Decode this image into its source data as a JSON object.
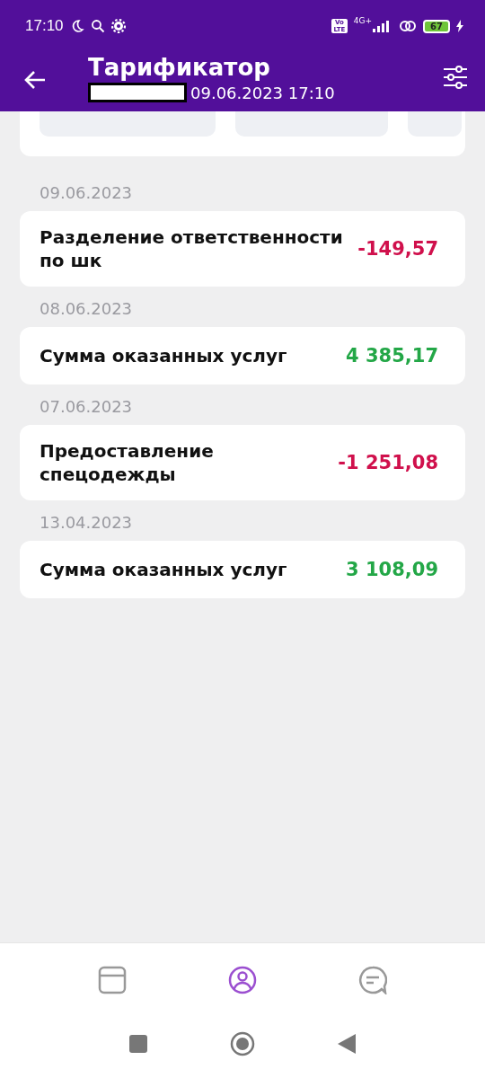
{
  "status_bar": {
    "time": "17:10",
    "network": "4G+",
    "volte": "Vo LTE",
    "battery": "67"
  },
  "header": {
    "title": "Тарификатор",
    "subtitle": "09.06.2023 17:10"
  },
  "groups": [
    {
      "date": "09.06.2023",
      "items": [
        {
          "name": "Разделение ответственности по шк",
          "amount": "-149,57",
          "color": "#d0104c"
        }
      ]
    },
    {
      "date": "08.06.2023",
      "items": [
        {
          "name": "Сумма оказанных услуг",
          "amount": "4 385,17",
          "color": "#23a747"
        }
      ]
    },
    {
      "date": "07.06.2023",
      "items": [
        {
          "name": "Предоставление спецодежды",
          "amount": "-1 251,08",
          "color": "#d0104c"
        }
      ]
    },
    {
      "date": "13.04.2023",
      "items": [
        {
          "name": "Сумма оказанных услуг",
          "amount": "3 108,09",
          "color": "#23a747"
        }
      ]
    }
  ],
  "bottom_nav": [
    {
      "kind": "card",
      "selected": false
    },
    {
      "kind": "profile",
      "selected": true
    },
    {
      "kind": "chat",
      "selected": false
    }
  ]
}
